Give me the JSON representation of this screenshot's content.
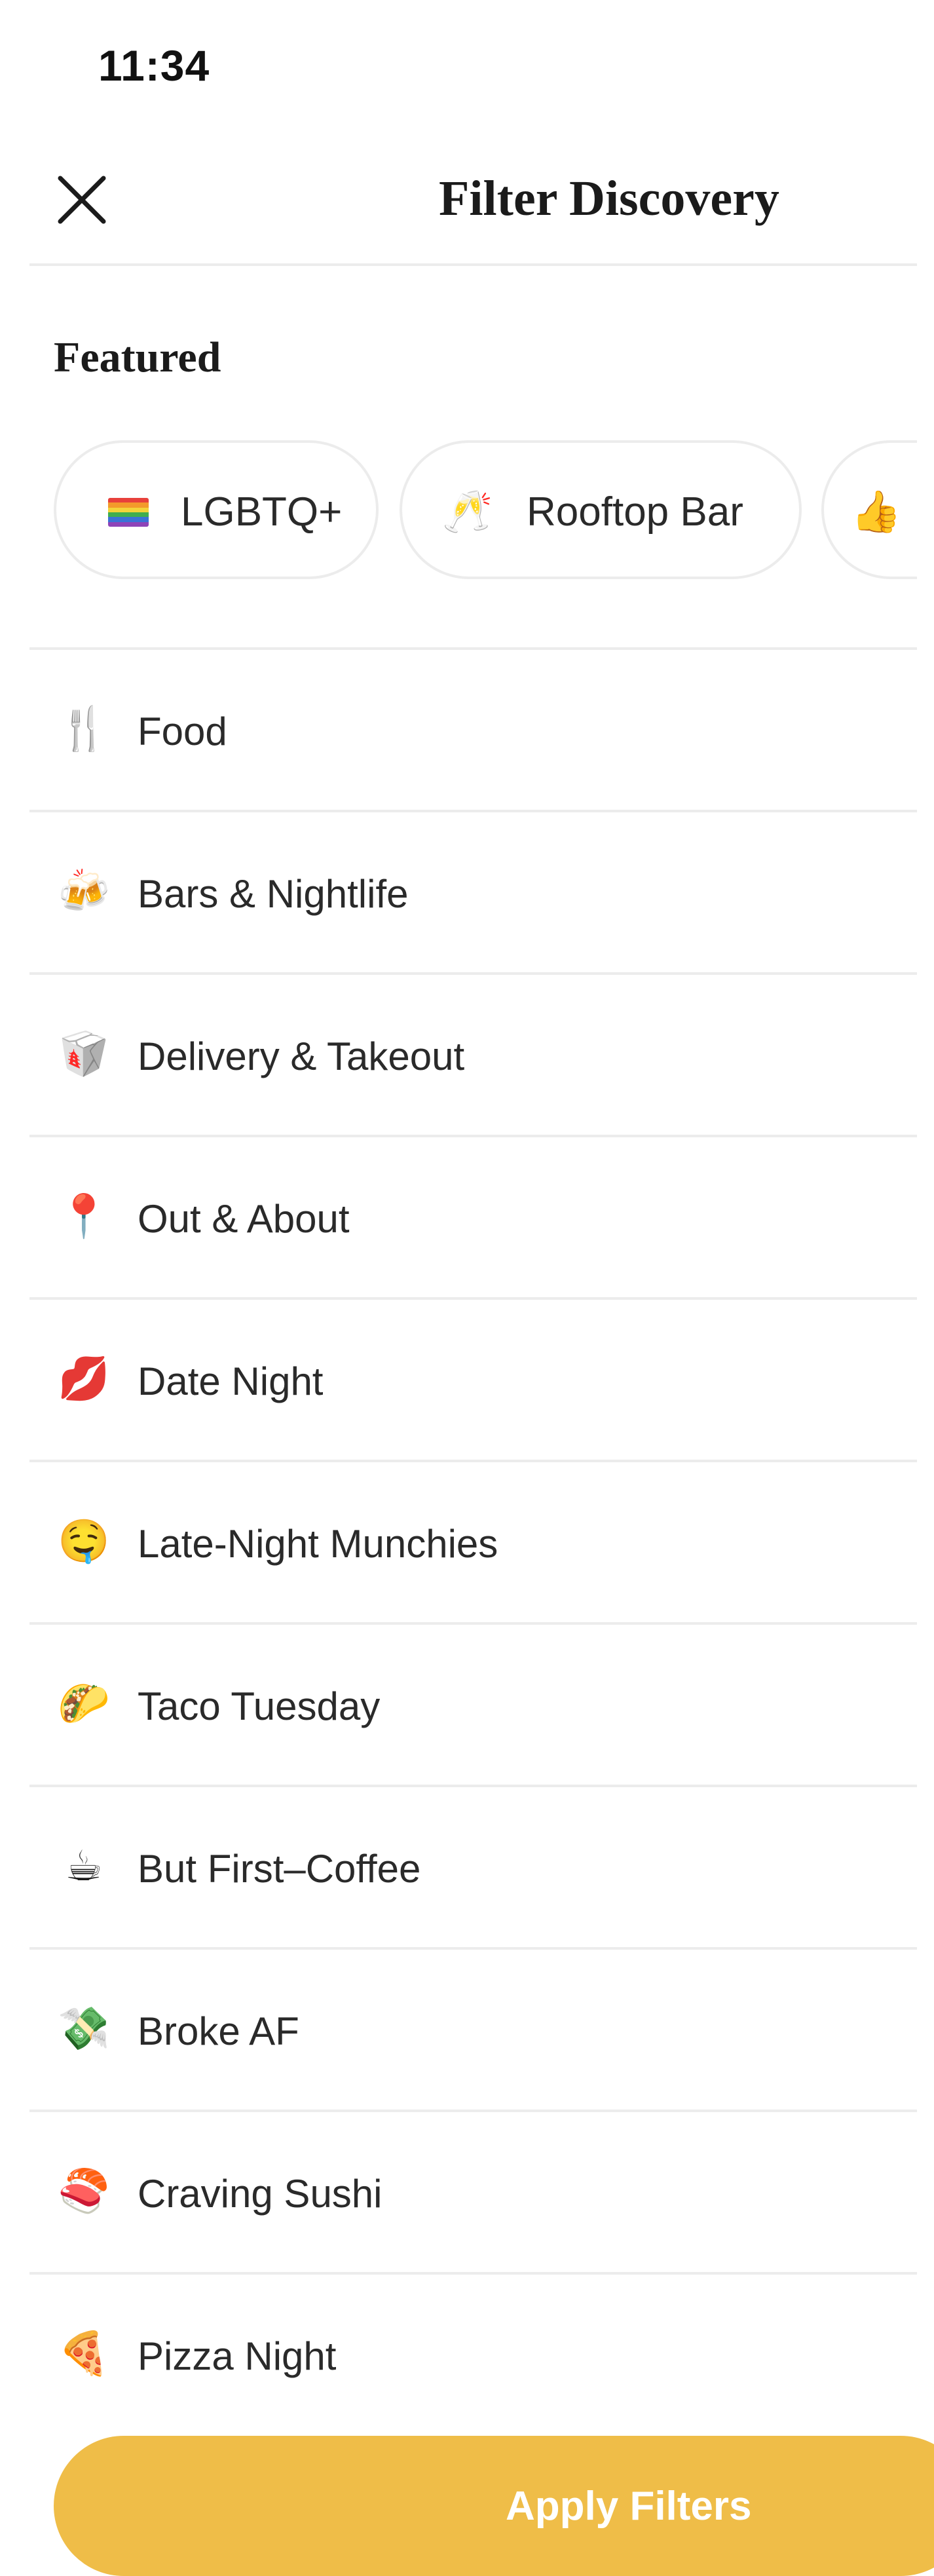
{
  "status_bar": {
    "time": "11:34"
  },
  "header": {
    "title": "Filter Discovery",
    "close_icon": "close-icon"
  },
  "featured": {
    "title": "Featured",
    "chips": [
      {
        "label": "LGBTQ+",
        "icon": "rainbow-flag-icon"
      },
      {
        "label": "Rooftop Bar",
        "icon": "champagne-toast-icon"
      },
      {
        "label": "",
        "icon": "thumbs-up-icon"
      }
    ]
  },
  "categories": [
    {
      "label": "Food",
      "icon": "fork-knife-icon"
    },
    {
      "label": "Bars & Nightlife",
      "icon": "beer-mugs-icon"
    },
    {
      "label": "Delivery & Takeout",
      "icon": "takeout-box-icon"
    },
    {
      "label": "Out & About",
      "icon": "map-pin-icon"
    },
    {
      "label": "Date Night",
      "icon": "lips-icon"
    },
    {
      "label": "Late-Night Munchies",
      "icon": "drooling-face-icon"
    },
    {
      "label": "Taco Tuesday",
      "icon": "taco-icon"
    },
    {
      "label": "But First–Coffee",
      "icon": "coffee-icon"
    },
    {
      "label": "Broke AF",
      "icon": "flying-money-icon"
    },
    {
      "label": "Craving Sushi",
      "icon": "sushi-icon"
    },
    {
      "label": "Pizza Night",
      "icon": "pizza-icon"
    }
  ],
  "apply_button": {
    "label": "Apply Filters"
  },
  "colors": {
    "accent": "#efbd48",
    "divider": "#ececec",
    "text": "#1b1b1b"
  }
}
